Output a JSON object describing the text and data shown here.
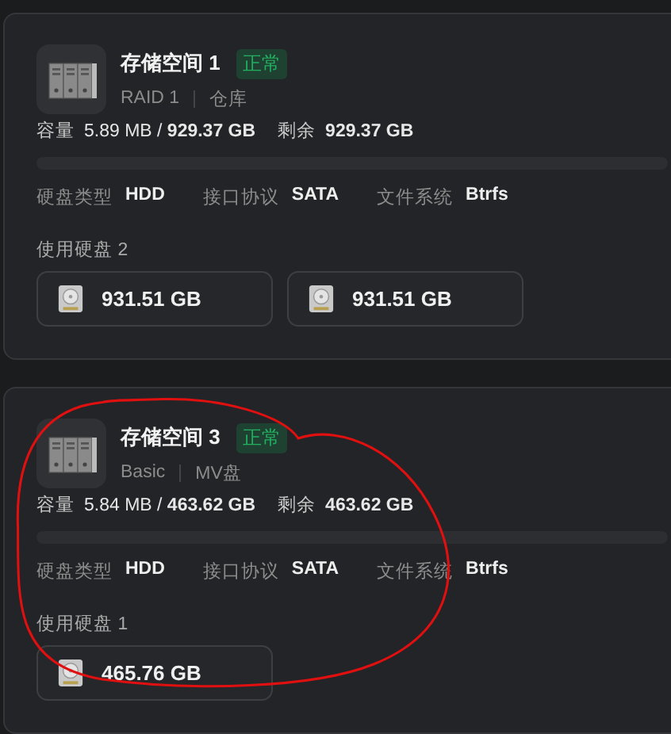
{
  "pools": [
    {
      "name": "存储空间 1",
      "status": "正常",
      "status_ok": true,
      "raid": "RAID 1",
      "alias": "仓库",
      "capacity_label": "容量",
      "capacity": "5.89 MB / **929.37 GB**",
      "free_label": "剩余",
      "free": "929.37 GB",
      "level": 0,
      "specs": [
        {
          "label": "硬盘类型",
          "value": "HDD"
        },
        {
          "label": "接口协议",
          "value": "SATA"
        },
        {
          "label": "文件系统",
          "value": "Btrfs"
        }
      ],
      "disks_label": "使用硬盘 2",
      "disks": [
        {
          "size": "931.51 GB"
        },
        {
          "size": "931.51 GB"
        }
      ]
    },
    {
      "name": "存储空间 3",
      "status": "正常",
      "status_ok": true,
      "raid": "Basic",
      "alias": "MV盘",
      "capacity_label": "容量",
      "capacity": "5.84 MB / **463.62 GB**",
      "free_label": "剩余",
      "free": "463.62 GB",
      "level": 0,
      "specs": [
        {
          "label": "硬盘类型",
          "value": "HDD"
        },
        {
          "label": "接口协议",
          "value": "SATA"
        },
        {
          "label": "文件系统",
          "value": "Btrfs"
        }
      ],
      "disks_label": "使用硬盘 1",
      "disks": [
        {
          "size": "465.76 GB"
        }
      ]
    }
  ]
}
